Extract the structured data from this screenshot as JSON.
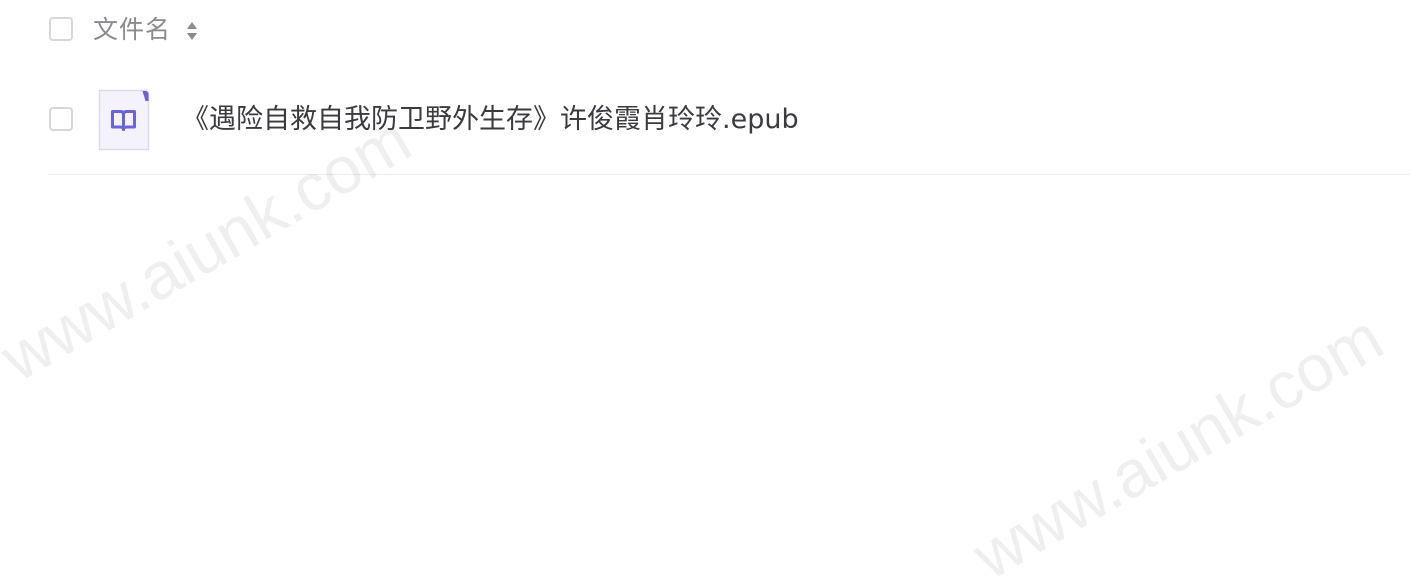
{
  "table": {
    "header": {
      "column_label": "文件名",
      "sort_icon": "sort-updown-icon"
    },
    "rows": [
      {
        "file_name": "《遇险自救自我防卫野外生存》许俊霞肖玲玲.epub",
        "file_icon": "book-icon",
        "file_type": "epub"
      }
    ]
  },
  "watermark": "www.aiunk.com",
  "colors": {
    "icon_accent": "#6b63d8",
    "icon_bg": "#f3f2fb",
    "text_primary": "#3a3a40",
    "text_header": "#8a8a8f",
    "checkbox_border": "#d6d6db",
    "divider": "#ebebee"
  }
}
